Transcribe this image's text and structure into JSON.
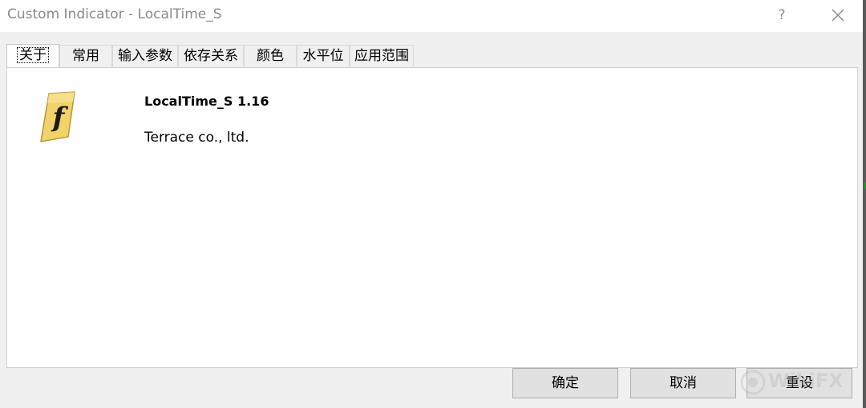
{
  "window": {
    "title": "Custom Indicator - LocalTime_S",
    "help_label": "?"
  },
  "tabs": [
    {
      "label": "关于",
      "active": true
    },
    {
      "label": "常用",
      "active": false
    },
    {
      "label": "输入参数",
      "active": false
    },
    {
      "label": "依存关系",
      "active": false
    },
    {
      "label": "颜色",
      "active": false
    },
    {
      "label": "水平位",
      "active": false
    },
    {
      "label": "应用范围",
      "active": false
    }
  ],
  "about": {
    "icon": "script-function-icon",
    "icon_glyph": "f",
    "name_version": "LocalTime_S 1.16",
    "company": "Terrace co., ltd."
  },
  "buttons": {
    "ok": "确定",
    "cancel": "取消",
    "reset": "重设"
  },
  "watermark": {
    "text": "WikiFX"
  },
  "colors": {
    "icon_gold": "#f2d36b",
    "icon_edge": "#b8963a",
    "button_face": "#e1e1e1"
  }
}
